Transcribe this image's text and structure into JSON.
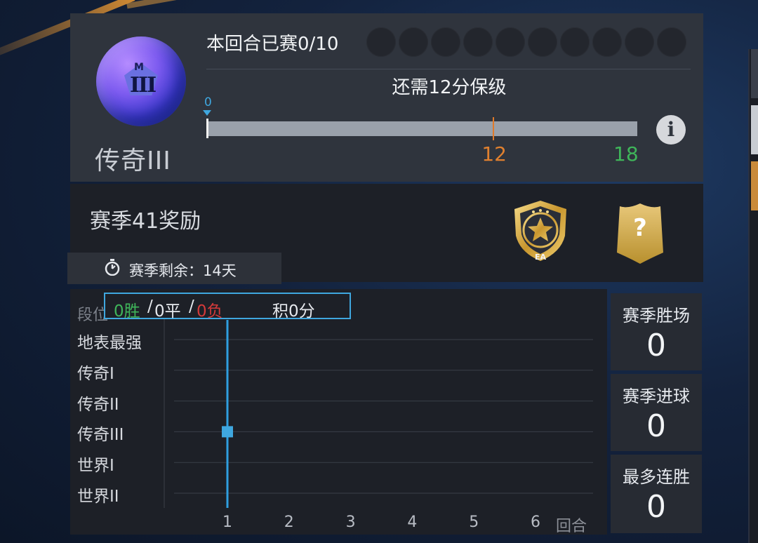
{
  "rank": {
    "name": "传奇III",
    "badge_letter": "M",
    "badge_numeral": "III"
  },
  "progress": {
    "match_text": "本回合已赛0/10",
    "matches_played": 0,
    "matches_total": 10,
    "need_text": "还需12分保级",
    "start_label": "0",
    "current_value": 0,
    "marker_label": "12",
    "marker_value": 12,
    "max_label": "18",
    "max_value": 18,
    "marker_color": "#e0802f",
    "max_color": "#3fb55a",
    "info_icon": "info-icon",
    "info_glyph": "i"
  },
  "season": {
    "title": "赛季41奖励",
    "timer_icon": "stopwatch-icon",
    "timer_text": "赛季剩余：14天",
    "reward_badge_icon": "gold-star-shield-icon",
    "reward_badge_text": "EA",
    "reward_mystery_icon": "mystery-card-icon",
    "reward_mystery_glyph": "?"
  },
  "chart_data": {
    "type": "line",
    "legend": {
      "wins": "0胜",
      "sep1": "/",
      "draws": "0平",
      "sep2": "/",
      "losses": "0负",
      "points": "积0分",
      "wins_color": "#3fb55a",
      "losses_color": "#d43a3a"
    },
    "ylabel": "段位",
    "xlabel": "回合",
    "y_categories": [
      "地表最强",
      "传奇I",
      "传奇II",
      "传奇III",
      "世界I",
      "世界II"
    ],
    "x": [
      1,
      2,
      3,
      4,
      5,
      6
    ],
    "x_labels": [
      "1",
      "2",
      "3",
      "4",
      "5",
      "6"
    ],
    "series": [
      {
        "points": [
          {
            "x": 1,
            "y": "传奇III"
          }
        ],
        "color": "#3fa7df"
      }
    ],
    "current_round": 1,
    "grid": true
  },
  "stats": [
    {
      "label": "赛季胜场",
      "value": "0"
    },
    {
      "label": "赛季进球",
      "value": "0"
    },
    {
      "label": "最多连胜",
      "value": "0"
    }
  ]
}
